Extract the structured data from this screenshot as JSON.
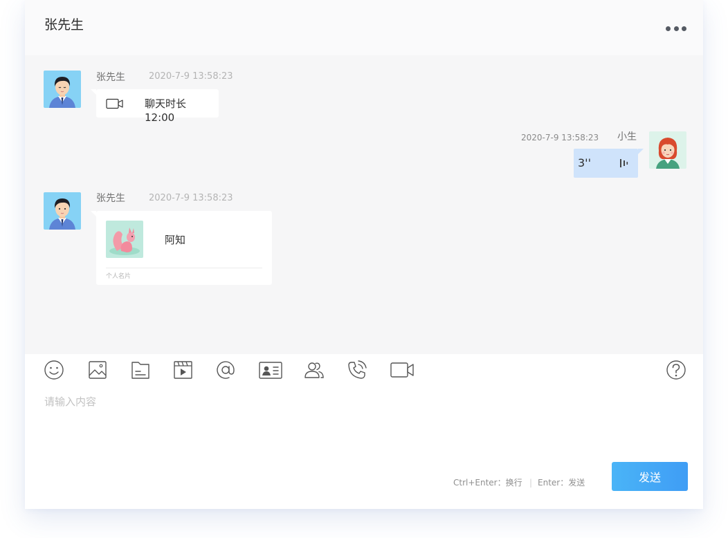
{
  "header": {
    "title": "张先生",
    "more_icon": "more-horizontal-icon"
  },
  "messages": [
    {
      "sender": "张先生",
      "time": "2020-7-9 13:58:23",
      "type": "video-call",
      "icon": "video-camera-icon",
      "text": "聊天时长 12:00"
    },
    {
      "sender": "小生",
      "time": "2020-7-9 13:58:23",
      "type": "voice",
      "duration": "3''",
      "icon": "voice-wave-icon"
    },
    {
      "sender": "张先生",
      "time": "2020-7-9 13:58:23",
      "type": "contact-card",
      "card_name": "阿知",
      "card_label": "个人名片"
    }
  ],
  "toolbar": {
    "icons": [
      "emoji-icon",
      "image-icon",
      "file-icon",
      "video-file-icon",
      "mention-icon",
      "contact-card-icon",
      "group-icon",
      "phone-call-icon",
      "video-call-icon",
      "help-icon"
    ]
  },
  "composer": {
    "placeholder": "请输入内容",
    "value": "",
    "hint_newline": "Ctrl+Enter：换行",
    "hint_separator": "|",
    "hint_send": "Enter：发送",
    "send_label": "发送"
  },
  "colors": {
    "accent": "#40a7f6",
    "self_bubble": "#cfe3fb",
    "chat_background": "#f6f6f7"
  }
}
